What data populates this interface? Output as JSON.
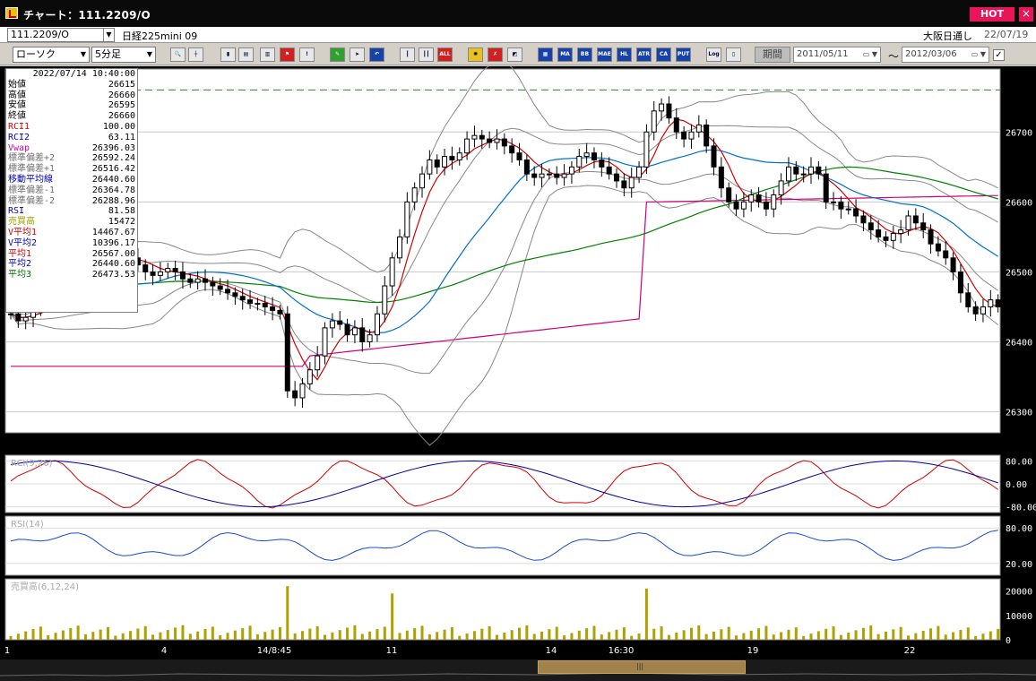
{
  "window": {
    "title": "チャート：111.2209/O",
    "hot_label": "HOT",
    "close_label": "×"
  },
  "header": {
    "code": "111.2209/O",
    "name": "日経225mini 09",
    "exchange": "大阪日通し",
    "date": "22/07/19"
  },
  "toolbar": {
    "chart_type": "ローソク",
    "interval": "5分足",
    "period_label": "期間",
    "date_from": "2011/05/11",
    "date_to": "2012/03/06",
    "tilde": "～",
    "check": "✓",
    "buttons": [
      "MA",
      "BB",
      "MAE",
      "HL",
      "ATR",
      "CA",
      "PUT",
      "Log"
    ]
  },
  "info_panel": {
    "datetime": "2022/07/14  10:40:00",
    "rows": [
      {
        "label": "始値",
        "value": "26615",
        "color": "#000000"
      },
      {
        "label": "高値",
        "value": "26660",
        "color": "#000000"
      },
      {
        "label": "安値",
        "value": "26595",
        "color": "#000000"
      },
      {
        "label": "終値",
        "value": "26660",
        "color": "#000000"
      },
      {
        "label": "RCI1",
        "value": "100.00",
        "color": "#d00000"
      },
      {
        "label": "RCI2",
        "value": "63.11",
        "color": "#0000c0"
      },
      {
        "label": "Vwap",
        "value": "26396.03",
        "color": "#d000a0"
      },
      {
        "label": "標準偏差+2",
        "value": "26592.24",
        "color": "#707070"
      },
      {
        "label": "標準偏差+1",
        "value": "26516.42",
        "color": "#707070"
      },
      {
        "label": "移動平均線",
        "value": "26440.60",
        "color": "#0000c0"
      },
      {
        "label": "標準偏差-1",
        "value": "26364.78",
        "color": "#707070"
      },
      {
        "label": "標準偏差-2",
        "value": "26288.96",
        "color": "#707070"
      },
      {
        "label": "RSI",
        "value": "81.58",
        "color": "#0000c0"
      },
      {
        "label": "売買高",
        "value": "15472",
        "color": "#a0a000"
      },
      {
        "label": "V平均1",
        "value": "14467.67",
        "color": "#d00000"
      },
      {
        "label": "V平均2",
        "value": "10396.17",
        "color": "#0000c0"
      },
      {
        "label": "平均1",
        "value": "26567.00",
        "color": "#d00000"
      },
      {
        "label": "平均2",
        "value": "26440.60",
        "color": "#0000c0"
      },
      {
        "label": "平均3",
        "value": "26473.53",
        "color": "#007000"
      }
    ]
  },
  "panes": {
    "rci_label": "RCI(9,26)",
    "rsi_label": "RSI(14)",
    "vol_label": "売買高(6,12,24)"
  },
  "chart_data": [
    {
      "type": "candlestick",
      "ylim": [
        26270,
        26790
      ],
      "yticks": [
        26300,
        26400,
        26500,
        26600,
        26700
      ],
      "xticks": [
        "1",
        "4",
        "14/8:45",
        "11",
        "14",
        "16:30",
        "19",
        "22"
      ],
      "reference_line": 26760,
      "close": [
        26440,
        26430,
        26435,
        26445,
        26455,
        26465,
        26475,
        26480,
        26485,
        26490,
        26495,
        26500,
        26505,
        26512,
        26520,
        26525,
        26520,
        26510,
        26500,
        26495,
        26500,
        26505,
        26500,
        26490,
        26485,
        26490,
        26485,
        26480,
        26475,
        26470,
        26465,
        26460,
        26455,
        26455,
        26450,
        26445,
        26440,
        26330,
        26320,
        26340,
        26360,
        26380,
        26420,
        26430,
        26425,
        26410,
        26420,
        26400,
        26410,
        26440,
        26480,
        26520,
        26550,
        26600,
        26620,
        26640,
        26660,
        26650,
        26665,
        26660,
        26670,
        26690,
        26695,
        26690,
        26685,
        26690,
        26680,
        26670,
        26660,
        26640,
        26635,
        26640,
        26640,
        26635,
        26640,
        26650,
        26665,
        26670,
        26660,
        26650,
        26640,
        26630,
        26620,
        26635,
        26650,
        26700,
        26730,
        26740,
        26720,
        26700,
        26690,
        26700,
        26710,
        26680,
        26650,
        26620,
        26600,
        26590,
        26600,
        26610,
        26600,
        26590,
        26610,
        26630,
        26650,
        26640,
        26640,
        26650,
        26640,
        26600,
        26600,
        26590,
        26590,
        26580,
        26570,
        26560,
        26550,
        26545,
        26555,
        26560,
        26580,
        26570,
        26560,
        26540,
        26530,
        26520,
        26500,
        26470,
        26450,
        26440,
        26450,
        26460,
        26450
      ],
      "ma_labels": [
        "平均1",
        "平均2",
        "平均3"
      ]
    },
    {
      "type": "line",
      "title": "RCI(9,26)",
      "ylim": [
        -100,
        100
      ],
      "yticks": [
        "80.00",
        "0.00",
        "-80.00"
      ]
    },
    {
      "type": "line",
      "title": "RSI(14)",
      "ylim": [
        0,
        100
      ],
      "yticks": [
        "80.00",
        "20.00"
      ]
    },
    {
      "type": "bar",
      "title": "売買高(6,12,24)",
      "yticks": [
        "20000",
        "10000",
        "0"
      ]
    }
  ],
  "colors": {
    "up": "#ffffff",
    "down": "#000000",
    "ma1": "#d00000",
    "ma2": "#0070d0",
    "ma3": "#008000",
    "vwap": "#d0007a",
    "bb": "#888888",
    "vol": "#b0a000"
  }
}
